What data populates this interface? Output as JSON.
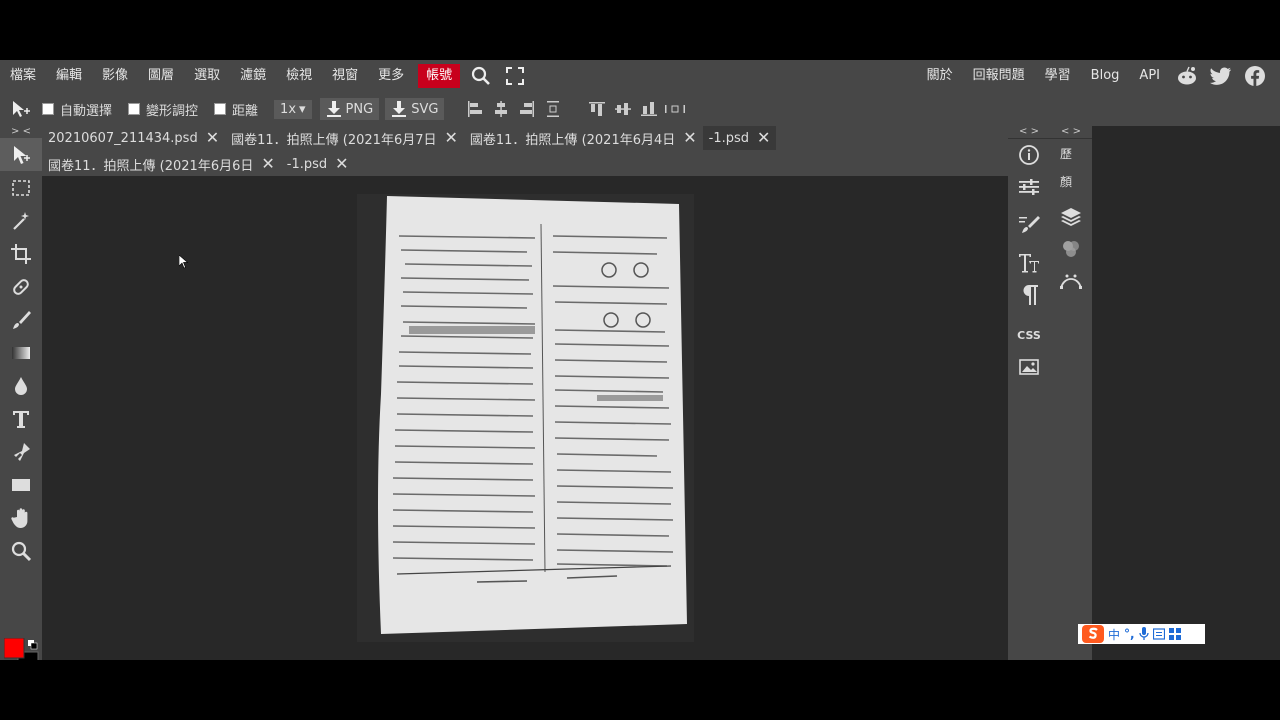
{
  "menu": {
    "items": [
      "檔案",
      "編輯",
      "影像",
      "圖層",
      "選取",
      "濾鏡",
      "檢視",
      "視窗",
      "更多"
    ],
    "highlight": "帳號",
    "right": [
      "關於",
      "回報問題",
      "學習",
      "Blog",
      "API"
    ]
  },
  "toolbar": {
    "auto_select": "自動選擇",
    "transform": "變形調控",
    "distance": "距離",
    "zoom": "1x",
    "png": "PNG",
    "svg": "SVG"
  },
  "tabs_row1": [
    {
      "label": "20210607_211434.psd",
      "active": false
    },
    {
      "label": "國卷11．拍照上傳 (2021年6月7日",
      "active": false
    },
    {
      "label": "國卷11．拍照上傳 (2021年6月4日",
      "active": false
    },
    {
      "label": "-1.psd",
      "active": true
    }
  ],
  "tabs_row2": [
    {
      "label": "國卷11．拍照上傳 (2021年6月6日",
      "active": false
    },
    {
      "label": "-1.psd",
      "active": false
    }
  ],
  "right_panel": {
    "history": "歷",
    "swatches": "顏"
  },
  "ime": {
    "label": "中"
  },
  "colors": {
    "foreground": "#ff0000",
    "background": "#000000",
    "accent": "#c8001c"
  }
}
